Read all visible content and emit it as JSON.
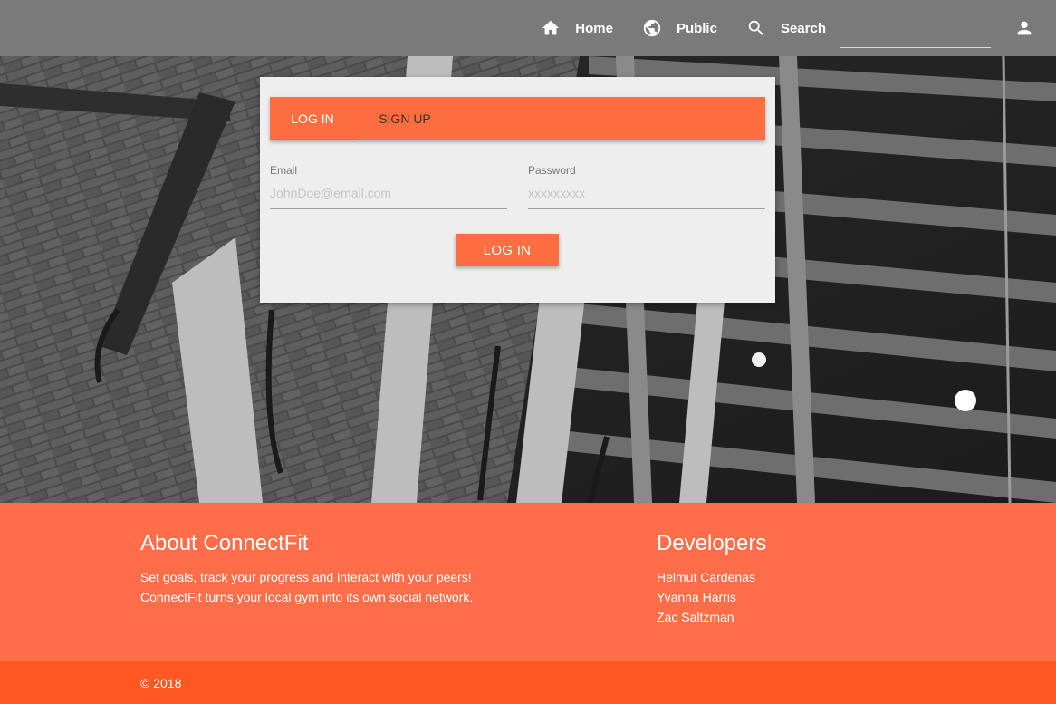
{
  "nav": {
    "home_label": "Home",
    "public_label": "Public",
    "search_label": "Search",
    "search_value": "",
    "icons": [
      "home-icon",
      "globe-icon",
      "search-icon",
      "account-icon"
    ]
  },
  "login_card": {
    "tabs": [
      {
        "label": "LOG IN",
        "active": true
      },
      {
        "label": "SIGN UP",
        "active": false
      }
    ],
    "email_label": "Email",
    "email_placeholder": "JohnDoe@email.com",
    "password_label": "Password",
    "password_placeholder": "xxxxxxxxx",
    "submit_label": "LOG IN"
  },
  "footer": {
    "about_title": "About ConnectFit",
    "about_text_line1": "Set goals, track your progress and interact with your peers!",
    "about_text_line2": "ConnectFit turns your local gym into its own social network.",
    "developers_title": "Developers",
    "developers": [
      "Helmut Cardenas",
      "Yvanna Harris",
      "Zac Saltzman"
    ],
    "copyright": "© 2018"
  },
  "colors": {
    "navbar": "#7a7a7a",
    "accent": "#ff6e40",
    "footer": "#ff6e48",
    "footer_bottom": "#ff5722",
    "card": "#eeeeee"
  }
}
